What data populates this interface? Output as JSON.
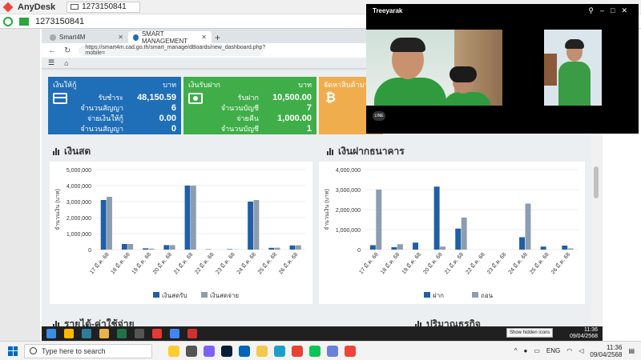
{
  "anydesk": {
    "app_name": "AnyDesk",
    "tab_label": "1273150841",
    "address_id": "1273150841"
  },
  "browser": {
    "tabs": [
      {
        "label": "Smart4M"
      },
      {
        "label": "SMART MANAGEMENT"
      }
    ],
    "url": "https://smart4m.cad.go.th/smart_manage/dBoards/new_dashboard.php?mobile="
  },
  "cards": {
    "loan": {
      "title": "เงินให้กู้",
      "unit": "บาท",
      "rows": [
        {
          "label": "รับชำระ",
          "value": "48,150.59"
        },
        {
          "label": "จำนวนสัญญา",
          "value": "6"
        },
        {
          "label": "จ่ายเงินให้กู้",
          "value": "0.00"
        },
        {
          "label": "จำนวนสัญญา",
          "value": "0"
        }
      ]
    },
    "deposit": {
      "title": "เงินรับฝาก",
      "unit": "บาท",
      "rows": [
        {
          "label": "รับฝาก",
          "value": "10,500.00"
        },
        {
          "label": "จำนวนบัญชี",
          "value": "7"
        },
        {
          "label": "จ่ายคืน",
          "value": "1,000.00"
        },
        {
          "label": "จำนวนบัญชี",
          "value": "1"
        }
      ]
    },
    "products": {
      "title": "จัดหาสินค้ามาจำ"
    }
  },
  "sections": {
    "cash_title": "เงินสด",
    "bank_title": "เงินฝากธนาคาร",
    "income_title": "รายได้-ค่าใช้จ่าย",
    "volume_title": "ปริมาณธุรกิจ"
  },
  "chart_data": [
    {
      "type": "bar",
      "title": "เงินสด",
      "ylabel": "จำนวนเงิน (บาท)",
      "ylim": [
        0,
        5000000
      ],
      "yticks": [
        "0",
        "1,000,000",
        "2,000,000",
        "3,000,000",
        "4,000,000",
        "5,000,000"
      ],
      "categories": [
        "17 มี.ค. 68",
        "18 มี.ค. 68",
        "19 มี.ค. 68",
        "20 มี.ค. 68",
        "21 มี.ค. 68",
        "22 มี.ค. 68",
        "23 มี.ค. 68",
        "24 มี.ค. 68",
        "25 มี.ค. 68",
        "26 มี.ค. 68"
      ],
      "series": [
        {
          "name": "เงินสดรับ",
          "color": "#1f5fa6",
          "values": [
            3100000,
            350000,
            80000,
            280000,
            4000000,
            20000,
            30000,
            3000000,
            110000,
            260000
          ]
        },
        {
          "name": "เงินสดจ่าย",
          "color": "#8c9db0",
          "values": [
            3300000,
            350000,
            60000,
            280000,
            4000000,
            0,
            10000,
            3100000,
            120000,
            270000
          ]
        }
      ],
      "legend": "bottom"
    },
    {
      "type": "bar",
      "title": "เงินฝากธนาคาร",
      "ylabel": "จำนวนเงิน (บาท)",
      "ylim": [
        0,
        4000000
      ],
      "yticks": [
        "0",
        "1,000,000",
        "2,000,000",
        "3,000,000",
        "4,000,000"
      ],
      "categories": [
        "17 มี.ค. 68",
        "18 มี.ค. 68",
        "19 มี.ค. 68",
        "20 มี.ค. 68",
        "21 มี.ค. 68",
        "22 มี.ค. 68",
        "23 มี.ค. 68",
        "24 มี.ค. 68",
        "25 มี.ค. 68",
        "26 มี.ค. 68"
      ],
      "series": [
        {
          "name": "ฝาก",
          "color": "#1f5fa6",
          "values": [
            220000,
            120000,
            350000,
            3150000,
            1050000,
            0,
            0,
            620000,
            150000,
            200000
          ]
        },
        {
          "name": "ถอน",
          "color": "#8c9db0",
          "values": [
            3000000,
            270000,
            0,
            150000,
            1600000,
            0,
            0,
            2300000,
            0,
            60000
          ]
        }
      ],
      "legend": "bottom"
    }
  ],
  "video_call": {
    "caller_name": "Treeyarak",
    "badge": "LINE"
  },
  "remote_taskbar": {
    "tooltip": "Show hidden icons",
    "time": "11:36",
    "date": "09/04/2568"
  },
  "taskbar": {
    "search_placeholder": "Type here to search",
    "language": "ENG",
    "time": "11:36",
    "date": "09/04/2568"
  }
}
